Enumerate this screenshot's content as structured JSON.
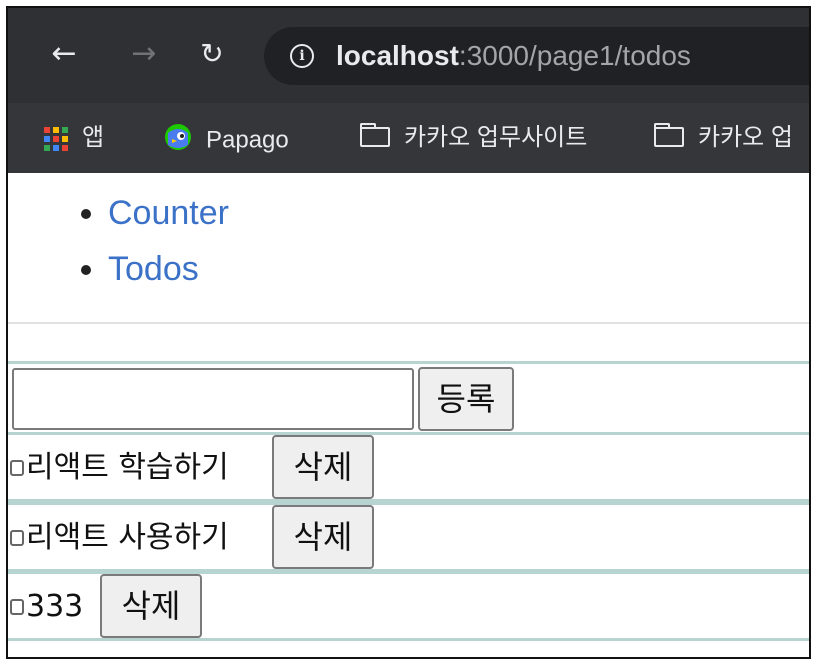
{
  "browser": {
    "url_host": "localhost",
    "url_path": ":3000/page1/todos",
    "bookmarks": [
      {
        "label": "앱",
        "icon": "apps-grid-icon"
      },
      {
        "label": "Papago",
        "icon": "papago-icon"
      },
      {
        "label": "카카오 업무사이트",
        "icon": "folder-icon"
      },
      {
        "label": "카카오 업",
        "icon": "folder-icon"
      }
    ]
  },
  "nav": {
    "items": [
      {
        "label": "Counter"
      },
      {
        "label": "Todos"
      }
    ]
  },
  "form": {
    "input_value": "",
    "add_label": "등록"
  },
  "todos": [
    {
      "text": "리액트 학습하기",
      "checked": false,
      "delete_label": "삭제"
    },
    {
      "text": "리액트 사용하기",
      "checked": false,
      "delete_label": "삭제"
    },
    {
      "text": "333",
      "checked": false,
      "delete_label": "삭제"
    }
  ],
  "colors": {
    "toolbar_bg": "#2f3033",
    "bookmarks_bg": "#35363a",
    "link": "#3b72c8",
    "row_border": "#b8d4d0"
  }
}
